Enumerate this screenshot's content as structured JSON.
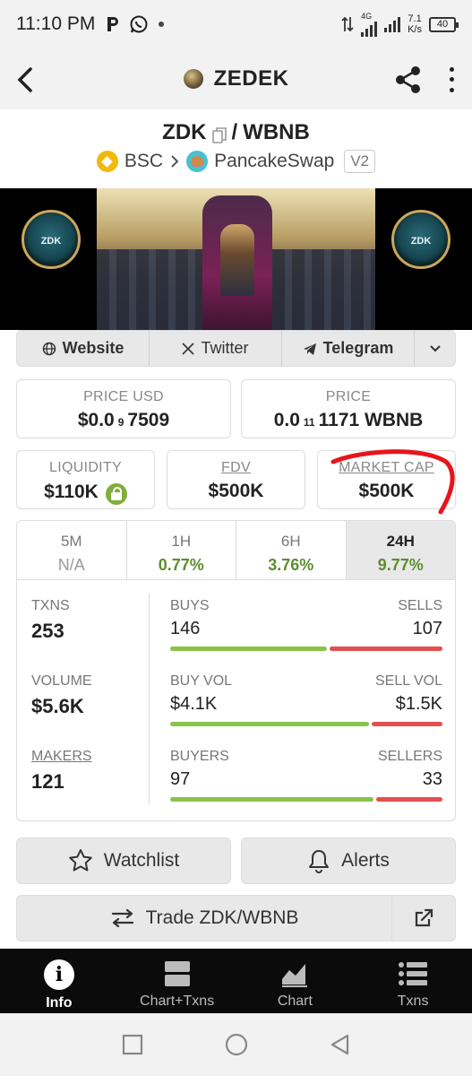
{
  "status_bar": {
    "time": "11:10 PM",
    "network": "4G",
    "speed_value": "7.1",
    "speed_unit": "K/s",
    "battery": "40"
  },
  "header": {
    "title": "ZEDEK"
  },
  "pair": {
    "base": "ZDK",
    "separator": "/",
    "quote": "WBNB",
    "chain": "BSC",
    "dex": "PancakeSwap",
    "version": "V2"
  },
  "banner": {
    "medal_text": "ZDK"
  },
  "links": {
    "website": "Website",
    "twitter": "Twitter",
    "telegram": "Telegram"
  },
  "prices": {
    "usd_label": "PRICE USD",
    "usd_prefix": "$0.0",
    "usd_zeros": "9",
    "usd_digits": "7509",
    "native_label": "PRICE",
    "native_prefix": "0.0",
    "native_zeros": "11",
    "native_digits": "1171 WBNB"
  },
  "metrics": {
    "liquidity_label": "LIQUIDITY",
    "liquidity_value": "$110K",
    "fdv_label": "FDV",
    "fdv_value": "$500K",
    "mcap_label": "MARKET CAP",
    "mcap_value": "$500K"
  },
  "timeframes": [
    {
      "label": "5M",
      "change": "N/A"
    },
    {
      "label": "1H",
      "change": "0.77%"
    },
    {
      "label": "6H",
      "change": "3.76%"
    },
    {
      "label": "24H",
      "change": "9.77%"
    }
  ],
  "stats": {
    "txns_label": "TXNS",
    "txns_value": "253",
    "volume_label": "VOLUME",
    "volume_value": "$5.6K",
    "makers_label": "MAKERS",
    "makers_value": "121",
    "buys_label": "BUYS",
    "buys_value": "146",
    "sells_label": "SELLS",
    "sells_value": "107",
    "buy_vol_label": "BUY VOL",
    "buy_vol_value": "$4.1K",
    "sell_vol_label": "SELL VOL",
    "sell_vol_value": "$1.5K",
    "buyers_label": "BUYERS",
    "buyers_value": "97",
    "sellers_label": "SELLERS",
    "sellers_value": "33",
    "buys_ratio": 0.577,
    "buy_vol_ratio": 0.73,
    "buyers_ratio": 0.746
  },
  "actions": {
    "watchlist": "Watchlist",
    "alerts": "Alerts",
    "trade": "Trade ZDK/WBNB"
  },
  "bottom_nav": [
    {
      "label": "Info",
      "icon": "info-icon"
    },
    {
      "label": "Chart+Txns",
      "icon": "split-layout-icon"
    },
    {
      "label": "Chart",
      "icon": "area-chart-icon"
    },
    {
      "label": "Txns",
      "icon": "list-icon"
    }
  ],
  "colors": {
    "positive": "#5a8f2f",
    "buy_bar": "#8bc34a",
    "sell_bar": "#e05050",
    "nav_bg": "#0b0b0b",
    "annotation": "#e8141b"
  }
}
